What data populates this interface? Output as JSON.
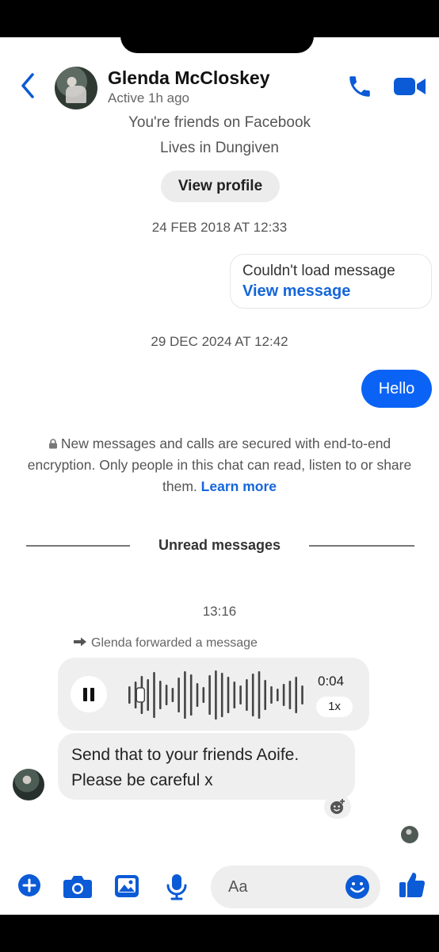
{
  "header": {
    "name": "Glenda McCloskey",
    "status": "Active 1h ago"
  },
  "profile": {
    "friends_text": "You're friends on Facebook",
    "lives_text": "Lives in Dungiven",
    "view_profile_label": "View profile"
  },
  "messages": {
    "ts1": "24 FEB 2018 AT 12:33",
    "failed_text": "Couldn't load message",
    "failed_link": "View message",
    "ts2": "29 DEC 2024 AT 12:42",
    "hello": "Hello",
    "e2e_text": "New messages and calls are secured with end-to-end encryption. Only people in this chat can read, listen to or share them.",
    "e2e_link": "Learn more",
    "unread_label": "Unread messages",
    "ts3": "13:16",
    "forwarded_text": "Glenda forwarded a message",
    "voice_duration": "0:04",
    "voice_speed": "1x",
    "voice_progress": 0.05,
    "text_line1": "Send that to your friends Aoife.",
    "text_line2": "Please be careful x"
  },
  "composer": {
    "placeholder": "Aa"
  },
  "colors": {
    "accent": "#0a63f5",
    "link": "#1566d9",
    "icon_blue": "#0b5ad6"
  },
  "icons": [
    "back-icon",
    "phone-icon",
    "video-icon",
    "lock-icon",
    "forward-arrow-icon",
    "pause-icon",
    "add-reaction-icon",
    "plus-icon",
    "camera-icon",
    "gallery-icon",
    "microphone-icon",
    "emoji-icon",
    "like-icon"
  ]
}
